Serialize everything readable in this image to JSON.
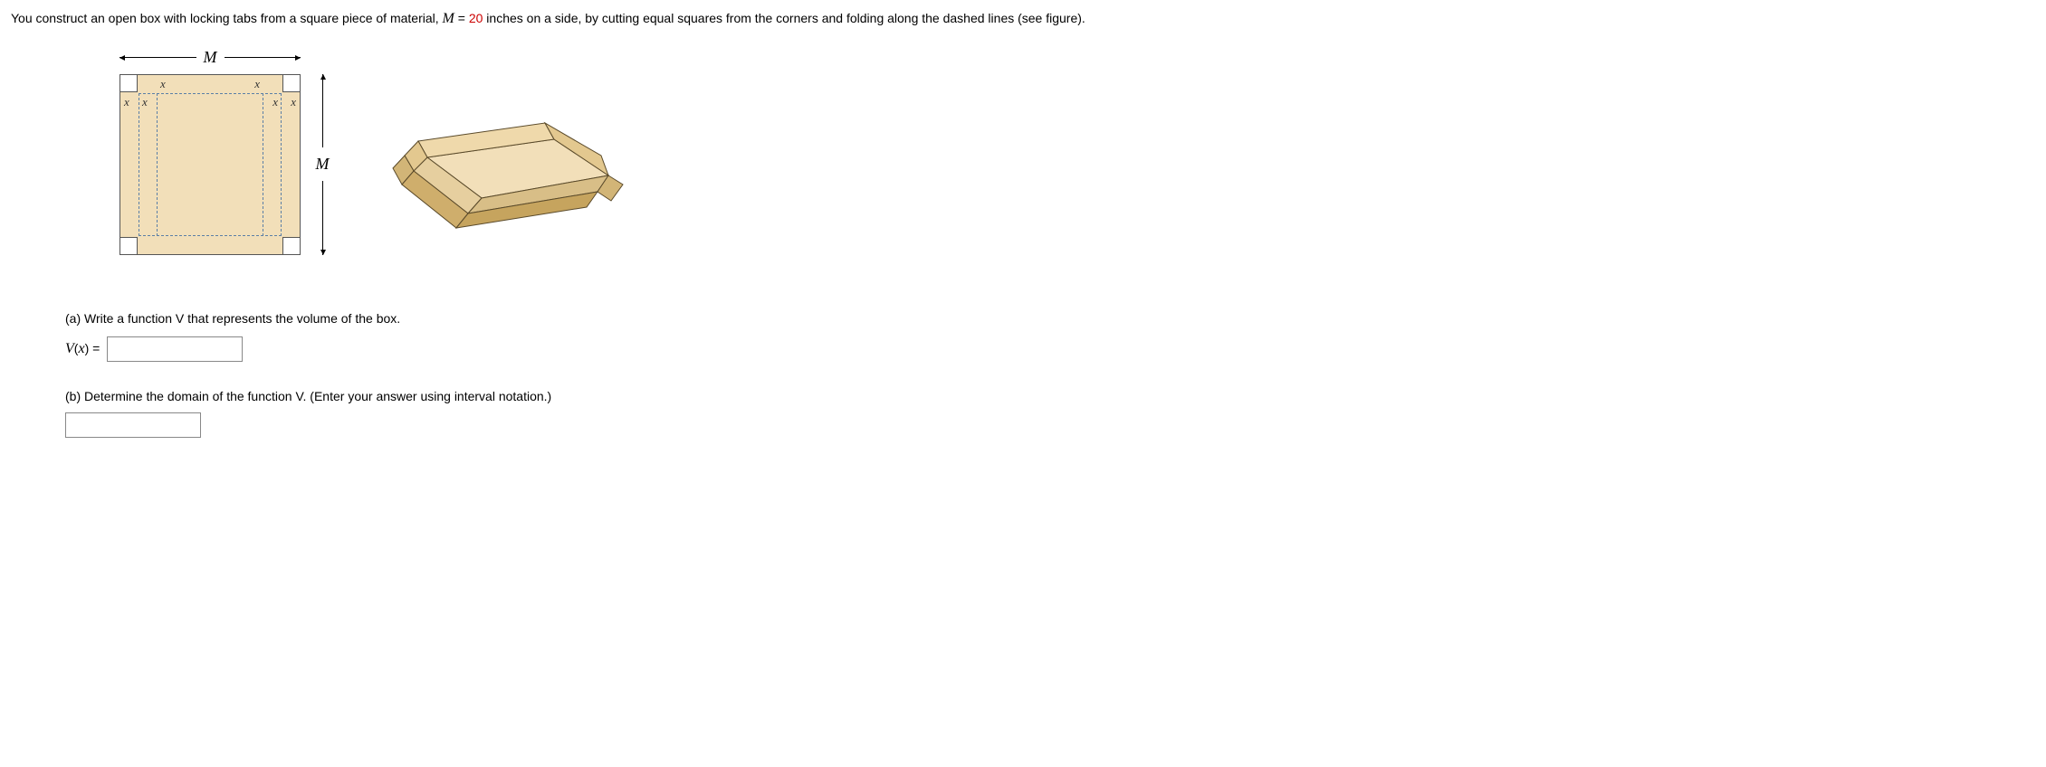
{
  "problem": {
    "intro_1": "You construct an open box with locking tabs from a square piece of material, ",
    "M_var": "M",
    "equals": " = ",
    "M_value": "20",
    "intro_2": " inches on a side, by cutting equal squares from the corners and folding along the dashed lines (see figure)."
  },
  "figure": {
    "dim_label_M_top": "M",
    "dim_label_M_right": "M",
    "x_labels": {
      "top_left_inner": "x",
      "top_right_inner": "x",
      "left_outer_1": "x",
      "left_outer_2": "x",
      "right_outer_1": "x",
      "right_outer_2": "x"
    }
  },
  "parts": {
    "a": {
      "prompt": "(a) Write a function  V  that represents the volume of the box.",
      "lhs_var": "V",
      "lhs_arg": "x",
      "value": ""
    },
    "b": {
      "prompt": "(b) Determine the domain of the function V. (Enter your answer using interval notation.)",
      "value": ""
    }
  }
}
